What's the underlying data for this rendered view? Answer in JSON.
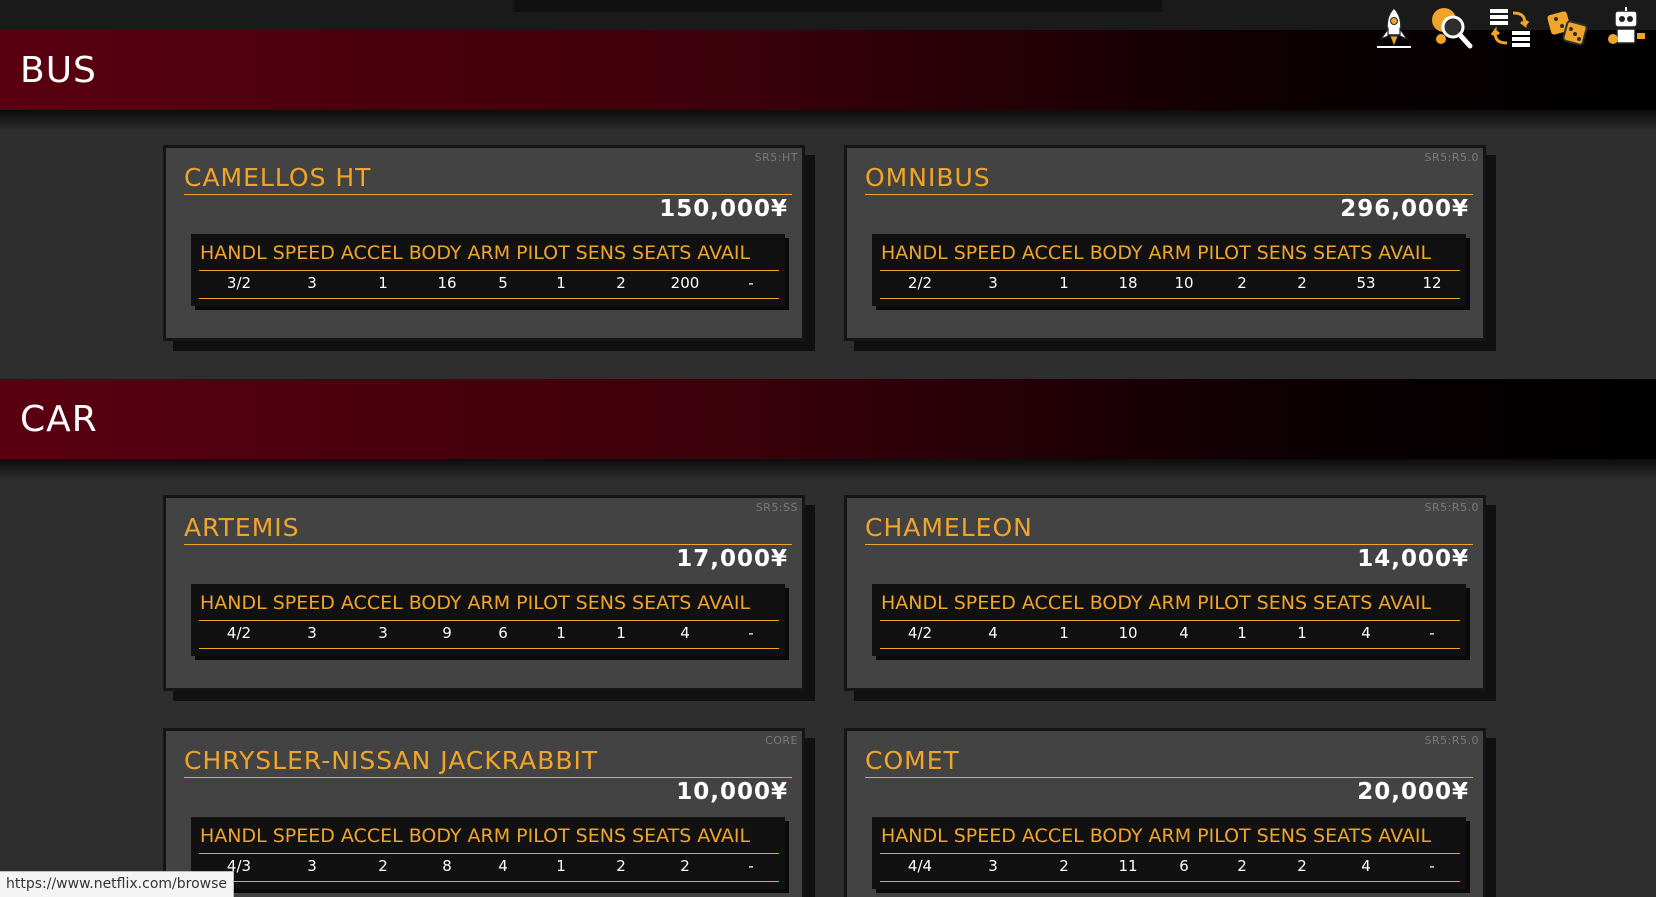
{
  "toolbar": {
    "icons": [
      "rocket-icon",
      "magnify-icon",
      "swap-icon",
      "dice-icon",
      "robot-icon"
    ]
  },
  "sections": [
    {
      "title": "BUS"
    },
    {
      "title": "CAR"
    }
  ],
  "stat_headers": [
    "HANDL",
    "SPEED",
    "ACCEL",
    "BODY",
    "ARM",
    "PILOT",
    "SENS",
    "SEATS",
    "AVAIL"
  ],
  "vehicles": [
    {
      "name": "CAMELLOS HT",
      "source": "SR5:HT",
      "price": "150,000¥",
      "stats": [
        "3/2",
        "3",
        "1",
        "16",
        "5",
        "1",
        "2",
        "200",
        "-"
      ]
    },
    {
      "name": "OMNIBUS",
      "source": "SR5:R5.0",
      "price": "296,000¥",
      "stats": [
        "2/2",
        "3",
        "1",
        "18",
        "10",
        "2",
        "2",
        "53",
        "12"
      ]
    },
    {
      "name": "ARTEMIS",
      "source": "SR5:SS",
      "price": "17,000¥",
      "stats": [
        "4/2",
        "3",
        "3",
        "9",
        "6",
        "1",
        "1",
        "4",
        "-"
      ]
    },
    {
      "name": "CHAMELEON",
      "source": "SR5:R5.0",
      "price": "14,000¥",
      "stats": [
        "4/2",
        "4",
        "1",
        "10",
        "4",
        "1",
        "1",
        "4",
        "-"
      ]
    },
    {
      "name": "CHRYSLER-NISSAN JACKRABBIT",
      "source": "CORE",
      "price": "10,000¥",
      "stats": [
        "4/3",
        "3",
        "2",
        "8",
        "4",
        "1",
        "2",
        "2",
        "-"
      ]
    },
    {
      "name": "COMET",
      "source": "SR5:R5.0",
      "price": "20,000¥",
      "stats": [
        "4/4",
        "3",
        "2",
        "11",
        "6",
        "2",
        "2",
        "4",
        "-"
      ]
    }
  ],
  "status_bar": {
    "url": "https://www.netflix.com/browse"
  },
  "colors": {
    "accent": "#f0a52a",
    "header_red": "#5a0011",
    "card_bg": "#434343",
    "page_bg": "#2e2e2e"
  }
}
